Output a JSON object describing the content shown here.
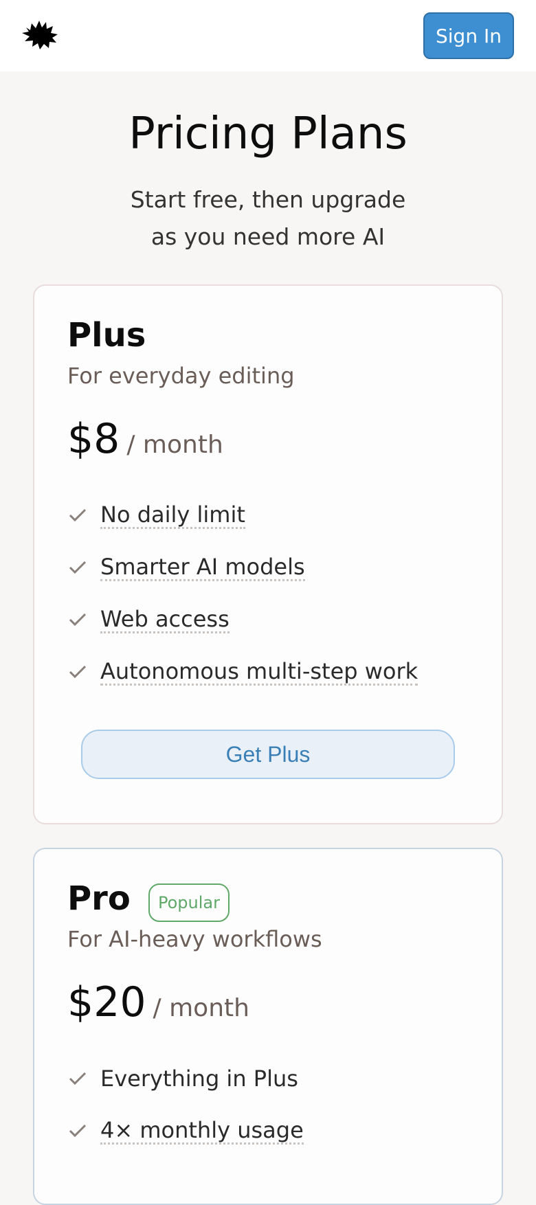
{
  "header": {
    "logo_icon": "splat-logo-icon",
    "signin_label": "Sign In"
  },
  "hero": {
    "title": "Pricing Plans",
    "subtitle_line1": "Start free, then upgrade",
    "subtitle_line2": "as you need more AI"
  },
  "plans": [
    {
      "name": "Plus",
      "description": "For everyday editing",
      "price": "$8",
      "period": "/ month",
      "features": [
        {
          "text": "No daily limit",
          "dotted": true
        },
        {
          "text": "Smarter AI models",
          "dotted": true
        },
        {
          "text": "Web access",
          "dotted": true
        },
        {
          "text": "Autonomous multi-step work",
          "dotted": true
        }
      ],
      "cta_label": "Get Plus"
    },
    {
      "name": "Pro",
      "badge": "Popular",
      "description": "For AI-heavy workflows",
      "price": "$20",
      "period": "/ month",
      "features": [
        {
          "text": "Everything in Plus",
          "dotted": false
        },
        {
          "text": "4× monthly usage",
          "dotted": true
        }
      ]
    }
  ],
  "colors": {
    "accent": "#3d8fd1",
    "badge_green": "#5fa868",
    "check_gray": "#8a807b",
    "background": "#f7f6f4"
  }
}
